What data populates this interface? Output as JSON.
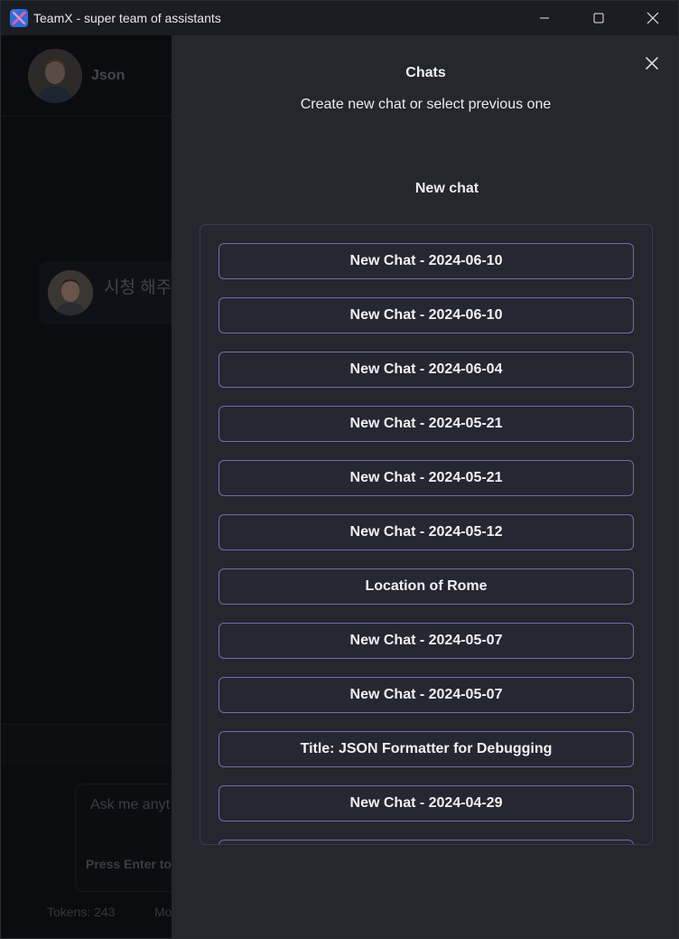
{
  "window": {
    "title": "TeamX - super team of assistants",
    "controls": [
      "minimize",
      "maximize",
      "close"
    ]
  },
  "background": {
    "username": "Json",
    "message_preview": "시청 해주",
    "input_placeholder": "Ask me anyt",
    "input_hint": "Press Enter to",
    "tokens_label": "Tokens: 243",
    "model_label": "Mo"
  },
  "drawer": {
    "title": "Chats",
    "subtitle": "Create new chat or select previous one",
    "new_chat_label": "New chat",
    "chats": [
      {
        "label": "New Chat - 2024-06-10"
      },
      {
        "label": "New Chat - 2024-06-10"
      },
      {
        "label": "New Chat - 2024-06-04"
      },
      {
        "label": "New Chat - 2024-05-21"
      },
      {
        "label": "New Chat - 2024-05-21"
      },
      {
        "label": "New Chat - 2024-05-12"
      },
      {
        "label": "Location of Rome"
      },
      {
        "label": "New Chat - 2024-05-07"
      },
      {
        "label": "New Chat - 2024-05-07"
      },
      {
        "label": "Title: JSON Formatter for Debugging"
      },
      {
        "label": "New Chat - 2024-04-29"
      },
      {
        "label": ""
      }
    ]
  },
  "colors": {
    "drawer_bg": "#25262e",
    "item_border": "#6a6fb0",
    "text": "#f1f1f3"
  }
}
